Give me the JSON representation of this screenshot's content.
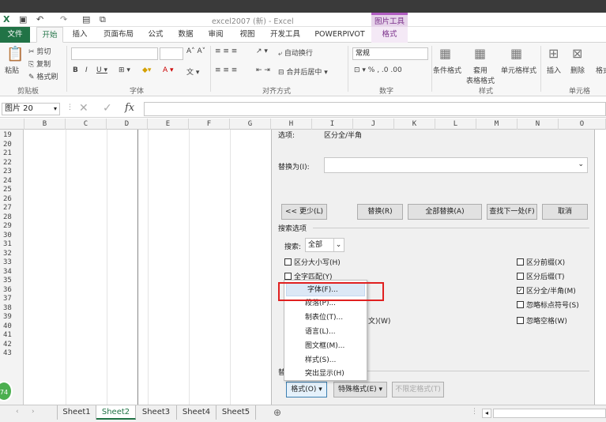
{
  "window": {
    "title": "excel2007 (新) - Excel",
    "context_label": "图片工具"
  },
  "tabs": [
    {
      "label": "文件"
    },
    {
      "label": "开始"
    },
    {
      "label": "插入"
    },
    {
      "label": "页面布局"
    },
    {
      "label": "公式"
    },
    {
      "label": "数据"
    },
    {
      "label": "审阅"
    },
    {
      "label": "视图"
    },
    {
      "label": "开发工具"
    },
    {
      "label": "POWERPIVOT"
    },
    {
      "label": "格式"
    }
  ],
  "ribbon": {
    "clipboard": {
      "paste": "粘贴",
      "cut": "剪切",
      "copy": "复制",
      "painter": "格式刷",
      "group": "剪贴板"
    },
    "font": {
      "group": "字体"
    },
    "align": {
      "wrap": "自动换行",
      "merge": "合并后居中",
      "group": "对齐方式"
    },
    "number": {
      "format": "常规",
      "group": "数字"
    },
    "styles": {
      "cond": "条件格式",
      "table": "套用\n表格格式",
      "cell": "单元格样式",
      "group": "样式"
    },
    "cells": {
      "insert": "插入",
      "delete": "删除",
      "format": "格式",
      "group": "单元格"
    }
  },
  "formula_bar": {
    "name_box": "图片 20",
    "fx": "fx",
    "value": ""
  },
  "columns": [
    "B",
    "C",
    "D",
    "E",
    "F",
    "G",
    "H",
    "I",
    "J",
    "K",
    "L",
    "M",
    "N",
    "O"
  ],
  "rows": [
    "19",
    "20",
    "21",
    "22",
    "23",
    "24",
    "25",
    "26",
    "27",
    "28",
    "29",
    "30",
    "31",
    "32",
    "33",
    "34",
    "35",
    "36",
    "37",
    "38",
    "39",
    "40",
    "41",
    "42",
    "43"
  ],
  "dialog": {
    "partial_top": "选项:",
    "partial_top_value": "区分全/半角",
    "replace_label": "替换为(I):",
    "replace_value": "",
    "buttons": {
      "less": "<< 更少(L)",
      "replace": "替换(R)",
      "replace_all": "全部替换(A)",
      "find_next": "查找下一处(F)",
      "cancel": "取消"
    },
    "search_options": "搜索选项",
    "search_label": "搜索:",
    "search_value": "全部",
    "left_opts": [
      "区分大小写(H)",
      "全字匹配(Y)"
    ],
    "right_opts": [
      {
        "label": "区分前缀(X)",
        "checked": false
      },
      {
        "label": "区分后缀(T)",
        "checked": false
      },
      {
        "label": "区分全/半角(M)",
        "checked": true
      },
      {
        "label": "忽略标点符号(S)",
        "checked": false
      },
      {
        "label": "忽略空格(W)",
        "checked": false
      }
    ],
    "hidden_partial": "文)(W)",
    "replace_section": "替",
    "format_button": "格式(O) ▾",
    "special_button": "特殊格式(E) ▾",
    "no_format_button": "不限定格式(T)"
  },
  "format_menu": [
    "字体(F)...",
    "段落(P)...",
    "制表位(T)...",
    "语言(L)...",
    "图文框(M)...",
    "样式(S)...",
    "突出显示(H)"
  ],
  "sheets": [
    "Sheet1",
    "Sheet2",
    "Sheet3",
    "Sheet4",
    "Sheet5"
  ],
  "active_sheet": "Sheet2",
  "badge": "74"
}
